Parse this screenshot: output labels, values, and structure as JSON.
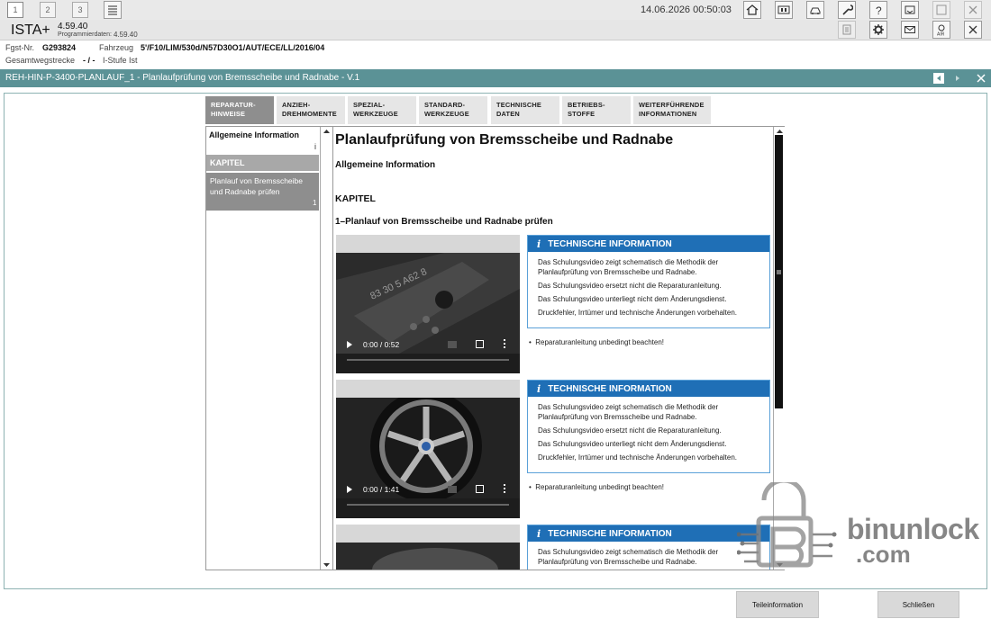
{
  "window_tabs": [
    "1",
    "2",
    "3"
  ],
  "datetime": "14.06.2026 00:50:03",
  "app": {
    "name": "ISTA+",
    "version": "4.59.40",
    "progdata_label": "Programmierdaten:",
    "progdata_value": "4.59.40"
  },
  "vehicle": {
    "fgst_label": "Fgst-Nr.",
    "fgst_value": "G293824",
    "fahrzeug_label": "Fahrzeug",
    "fahrzeug_value": "5'/F10/LIM/530d/N57D30O1/AUT/ECE/LL/2016/04",
    "gesamt_label": "Gesamtwegstrecke",
    "gesamt_value": "- / -",
    "istufe_label": "I-Stufe Ist"
  },
  "doc_title": "REH-HIN-P-3400-PLANLAUF_1 - Planlaufprüfung von Bremsscheibe und Radnabe - V.1",
  "tabs": [
    {
      "line1": "REPARATUR-",
      "line2": "HINWEISE",
      "active": true
    },
    {
      "line1": "ANZIEH-",
      "line2": "DREHMOMENTE",
      "active": false
    },
    {
      "line1": "SPEZIAL-",
      "line2": "WERKZEUGE",
      "active": false
    },
    {
      "line1": "STANDARD-",
      "line2": "WERKZEUGE",
      "active": false
    },
    {
      "line1": "TECHNISCHE",
      "line2": "DATEN",
      "active": false
    },
    {
      "line1": "BETRIEBS-",
      "line2": "STOFFE",
      "active": false
    },
    {
      "line1": "WEITERFÜHRENDE",
      "line2": "INFORMATIONEN",
      "active": false
    }
  ],
  "leftnav": {
    "allgemein": "Allgemeine Information",
    "allgemein_mark": "i",
    "kapitel": "KAPITEL",
    "item_label": "Planlauf von Bremsscheibe und Radnabe prüfen",
    "item_num": "1"
  },
  "content": {
    "title": "Planlaufprüfung von Bremsscheibe und Radnabe",
    "allgemein": "Allgemeine Information",
    "kapitel": "KAPITEL",
    "subtitle": "1–Planlauf von Bremsscheibe und Radnabe prüfen",
    "info_icon": "i",
    "info_heading": "TECHNISCHE INFORMATION",
    "info_lines": [
      "Das Schulungsvideo zeigt schematisch die Methodik der Planlaufprüfung von Bremsscheibe und Radnabe.",
      "Das Schulungsvideo ersetzt nicht die Reparaturanleitung.",
      "Das Schulungsvideo unterliegt nicht dem Änderungsdienst.",
      "Druckfehler, Irrtümer und technische Änderungen vorbehalten."
    ],
    "bullet": "Reparaturanleitung unbedingt beachten!",
    "videos": [
      {
        "time": "0:00 / 0:52"
      },
      {
        "time": "0:00 / 1:41"
      }
    ]
  },
  "buttons": {
    "teileinformation": "Teileinformation",
    "schliessen": "Schließen"
  },
  "watermark": {
    "text1": "binunlock",
    "text2": ".com"
  },
  "colors": {
    "titlebar": "#5b9296",
    "info_header": "#1f6fb6",
    "info_border": "#5ba1d8",
    "active_tab": "#8e8e8e"
  }
}
